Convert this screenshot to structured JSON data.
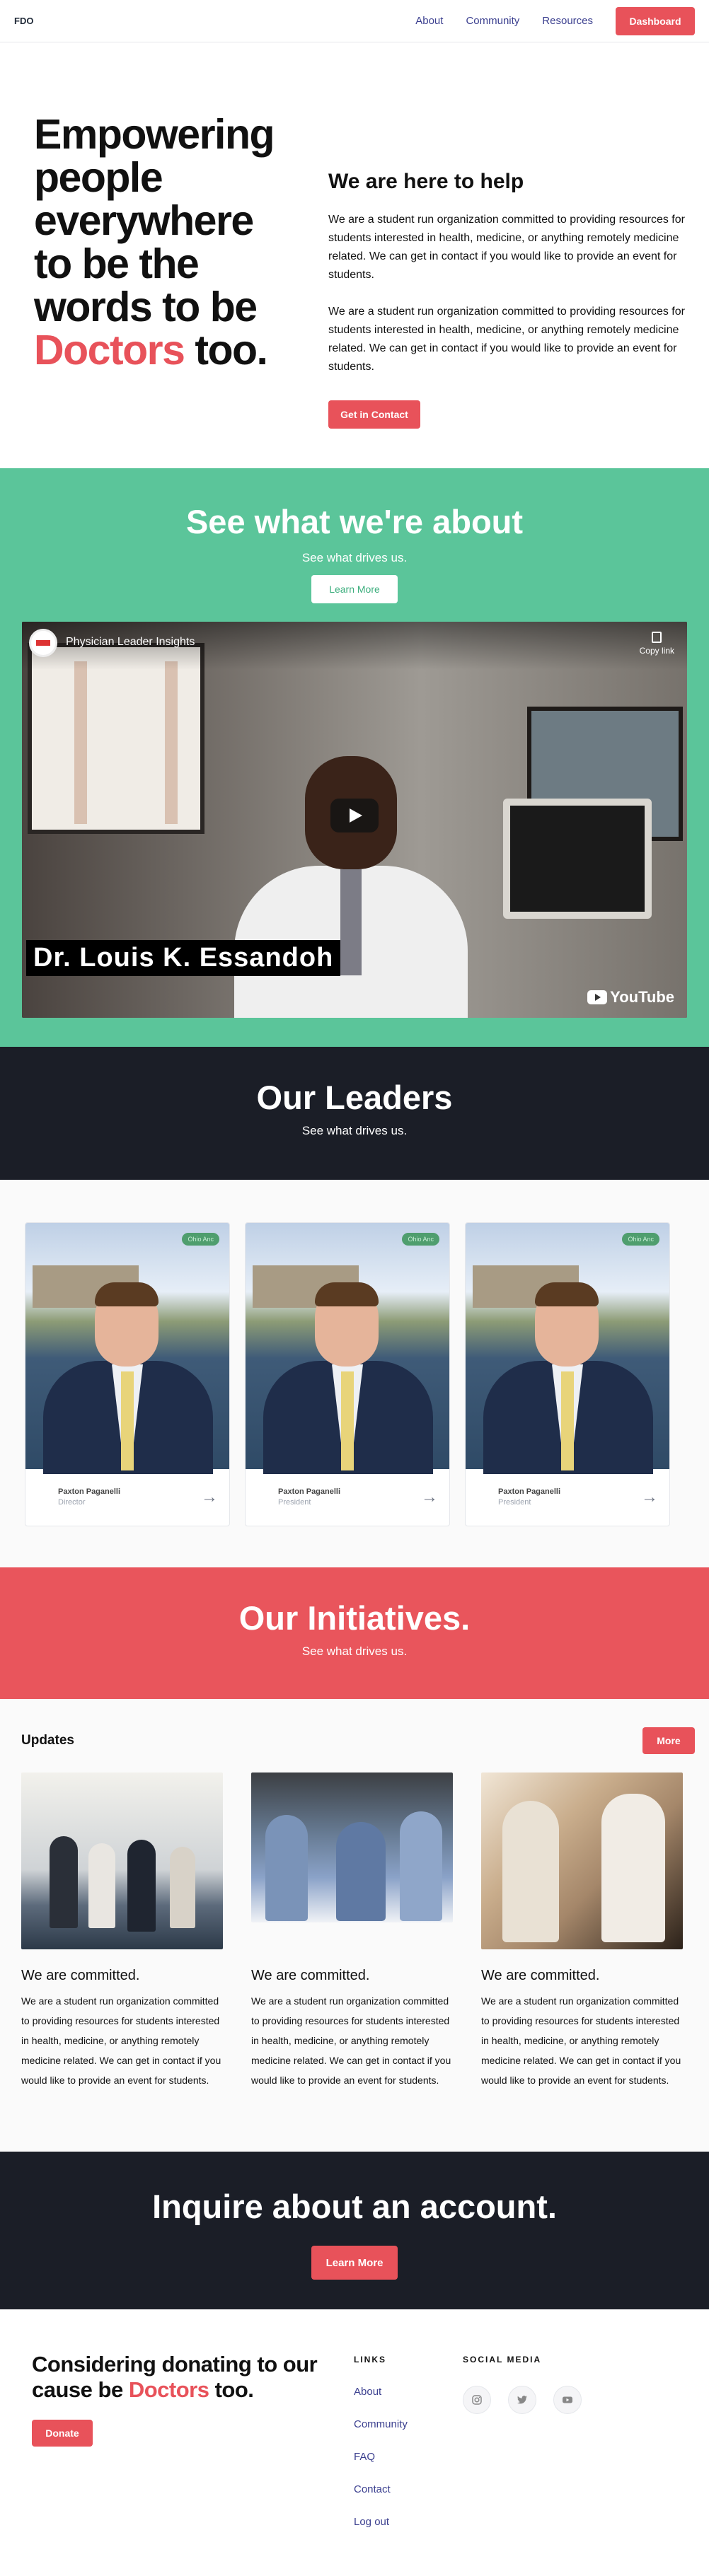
{
  "nav": {
    "brand": "FDO",
    "links": [
      "About",
      "Community",
      "Resources"
    ],
    "dashboard_label": "Dashboard"
  },
  "hero": {
    "title_lines": [
      "Empowering",
      "people",
      "everywhere",
      "to be the",
      "words to be"
    ],
    "title_accent": "Doctors",
    "title_end": " too.",
    "heading": "We are here to help",
    "paragraph_1": "We are a student run organization committed to providing resources for students interested in health, medicine, or anything remotely medicine related. We can get in contact if you would like to provide an event for students.",
    "paragraph_2": "We are a student run organization committed to providing resources for students interested in health, medicine, or anything remotely medicine related. We can get in contact if you would like to provide an event for students.",
    "contact_label": "Get in Contact"
  },
  "about": {
    "title": "See what we're about",
    "subtitle": "See what drives us.",
    "button_label": "Learn More",
    "video": {
      "title": "Physician Leader Insights",
      "copy_label": "Copy link",
      "caption": "Dr. Louis K. Essandoh",
      "platform": "YouTube"
    }
  },
  "leaders_band": {
    "title": "Our Leaders",
    "subtitle": "See what drives us."
  },
  "leaders": [
    {
      "name": "Paxton Paganelli",
      "role": "Director",
      "badge": "Ohio Anc"
    },
    {
      "name": "Paxton Paganelli",
      "role": "President",
      "badge": "Ohio Anc"
    },
    {
      "name": "Paxton Paganelli",
      "role": "President",
      "badge": "Ohio Anc"
    }
  ],
  "initiatives_band": {
    "title": "Our Initiatives.",
    "subtitle": "See what drives us."
  },
  "updates": {
    "heading": "Updates",
    "more_label": "More",
    "posts": [
      {
        "title": "We are committed.",
        "body": "We are a student run organization committed to providing resources for students interested in health, medicine, or anything remotely medicine related. We can get in contact if you would like to provide an event for students."
      },
      {
        "title": "We are committed.",
        "body": "We are a student run organization committed to providing resources for students interested in health, medicine, or anything remotely medicine related. We can get in contact if you would like to provide an event for students."
      },
      {
        "title": "We are committed.",
        "body": "We are a student run organization committed to providing resources for students interested in health, medicine, or anything remotely medicine related. We can get in contact if you would like to provide an event for students."
      }
    ]
  },
  "inquire": {
    "title": "Inquire about an account.",
    "button_label": "Learn More"
  },
  "footer": {
    "cta_line_1": "Considering donating to our",
    "cta_line_2_start": "cause be ",
    "cta_accent": "Doctors",
    "cta_end": " too.",
    "donate_label": "Donate",
    "links_heading": "LINKS",
    "links": [
      "About",
      "Community",
      "FAQ",
      "Contact",
      "Log out"
    ],
    "social_heading": "SOCIAL MEDIA",
    "social_icons": [
      "instagram-icon",
      "twitter-icon",
      "youtube-icon"
    ]
  },
  "colors": {
    "accent_red": "#e8525a",
    "green": "#5bc59a",
    "dark": "#1b1e27",
    "link": "#3b3f8f"
  }
}
